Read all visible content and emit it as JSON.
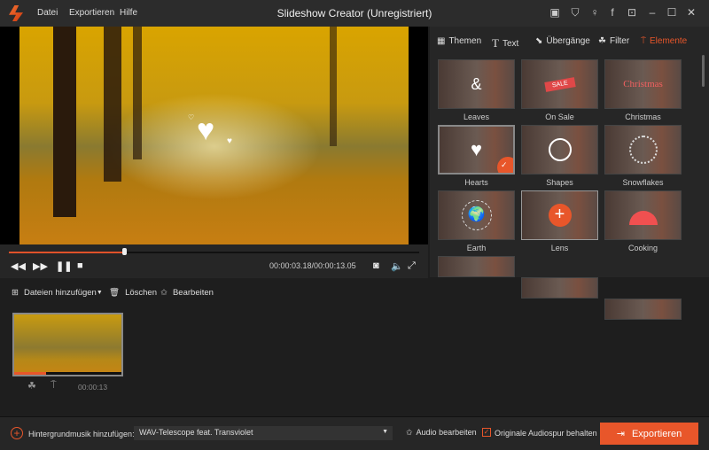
{
  "app": {
    "title": "Slideshow Creator (Unregistriert)",
    "menu": [
      "Datei",
      "Exportieren",
      "Hilfe"
    ]
  },
  "player": {
    "time": "00:00:03.18/00:00:13.05",
    "progress": 0.28
  },
  "tabs": [
    "Themen",
    "Text",
    "Übergänge",
    "Filter",
    "Elemente"
  ],
  "active_tab": "Elemente",
  "elements": [
    "Leaves",
    "On Sale",
    "Christmas",
    "Hearts",
    "Shapes",
    "Snowflakes",
    "Earth",
    "Lens",
    "Cooking"
  ],
  "toolbar": {
    "add": "Dateien hinzufügen",
    "delete": "Löschen",
    "edit": "Bearbeiten"
  },
  "clip": {
    "duration": "00:00:13"
  },
  "bottom": {
    "music_label": "Hintergrundmusik hinzufügen:",
    "music_value": "WAV-Telescope feat. Transviolet",
    "audio_edit": "Audio bearbeiten",
    "keep_audio": "Originale Audiospur behalten",
    "export": "Exportieren"
  },
  "colors": {
    "accent": "#e8562a"
  }
}
